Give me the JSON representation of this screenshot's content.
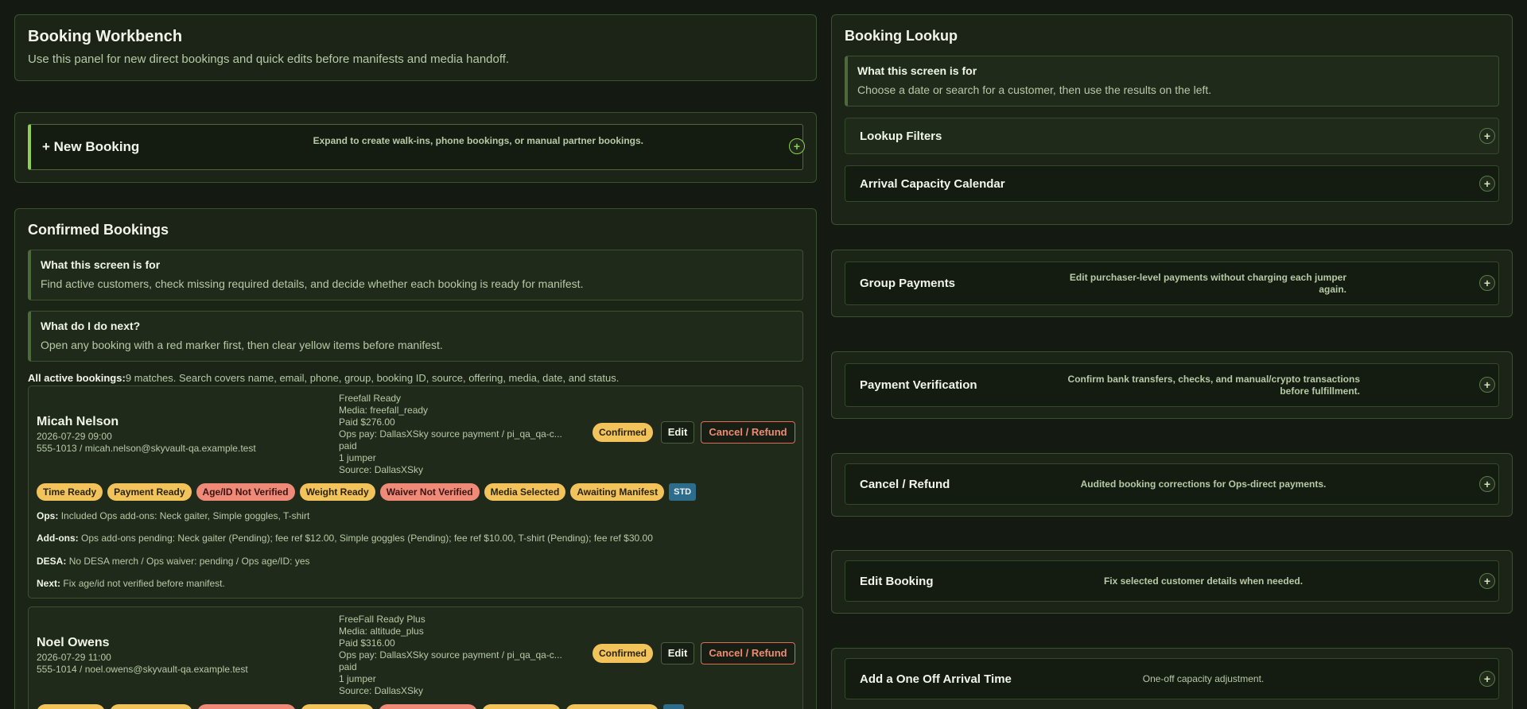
{
  "workbench": {
    "title": "Booking Workbench",
    "subtitle": "Use this panel for new direct bookings and quick edits before manifests and media handoff."
  },
  "new_booking": {
    "label": "+ New Booking",
    "description": "Expand to create walk-ins, phone bookings, or manual partner bookings.",
    "toggle": "+"
  },
  "confirmed": {
    "title": "Confirmed Bookings",
    "info1": {
      "title": "What this screen is for",
      "text": "Find active customers, check missing required details, and decide whether each booking is ready for manifest."
    },
    "info2": {
      "title": "What do I do next?",
      "text": "Open any booking with a red marker first, then clear yellow items before manifest."
    },
    "summary_label": "All active bookings:",
    "summary_text": "9 matches. Search covers name, email, phone, group, booking ID, source, offering, media, date, and status.",
    "bookings": [
      {
        "name": "Micah Nelson",
        "datetime": "2026-07-29 09:00",
        "contact": "555-1013 / micah.nelson@skyvault-qa.example.test",
        "offering": "Freefall Ready",
        "media": "Media: freefall_ready",
        "paid": "Paid $276.00",
        "ops_pay": "Ops pay: DallasXSky source payment / pi_qa_qa-c...",
        "pay_status": "paid",
        "jumpers": "1 jumper",
        "source": "Source: DallasXSky",
        "status": "Confirmed",
        "edit": "Edit",
        "cancel": "Cancel / Refund",
        "chips": [
          {
            "text": "Time Ready",
            "tone": "y"
          },
          {
            "text": "Payment Ready",
            "tone": "y"
          },
          {
            "text": "Age/ID Not Verified",
            "tone": "r"
          },
          {
            "text": "Weight Ready",
            "tone": "y"
          },
          {
            "text": "Waiver Not Verified",
            "tone": "r"
          },
          {
            "text": "Media Selected",
            "tone": "y"
          },
          {
            "text": "Awaiting Manifest",
            "tone": "y"
          },
          {
            "text": "STD",
            "tone": "std"
          }
        ],
        "ops_label": "Ops:",
        "ops_text": "Included Ops add-ons: Neck gaiter, Simple goggles, T-shirt",
        "addons_label": "Add-ons:",
        "addons_text": "Ops add-ons pending: Neck gaiter (Pending); fee ref $12.00, Simple goggles (Pending); fee ref $10.00, T-shirt (Pending); fee ref $30.00",
        "desa_label": "DESA:",
        "desa_text": "No DESA merch / Ops waiver: pending / Ops age/ID: yes",
        "next_label": "Next:",
        "next_text": "Fix age/id not verified before manifest."
      },
      {
        "name": "Noel Owens",
        "datetime": "2026-07-29 11:00",
        "contact": "555-1014 / noel.owens@skyvault-qa.example.test",
        "offering": "FreeFall Ready Plus",
        "media": "Media: altitude_plus",
        "paid": "Paid $316.00",
        "ops_pay": "Ops pay: DallasXSky source payment / pi_qa_qa-c...",
        "pay_status": "paid",
        "jumpers": "1 jumper",
        "source": "Source: DallasXSky",
        "status": "Confirmed",
        "edit": "Edit",
        "cancel": "Cancel / Refund"
      }
    ]
  },
  "lookup": {
    "title": "Booking Lookup",
    "info": {
      "title": "What this screen is for",
      "text": "Choose a date or search for a customer, then use the results on the left."
    },
    "filters": "Lookup Filters",
    "calendar": "Arrival Capacity Calendar"
  },
  "side_panels": [
    {
      "label": "Group Payments",
      "desc": "Edit purchaser-level payments without charging each jumper again."
    },
    {
      "label": "Payment Verification",
      "desc": "Confirm bank transfers, checks, and manual/crypto transactions before fulfillment."
    },
    {
      "label": "Cancel / Refund",
      "desc": "Audited booking corrections for Ops-direct payments."
    },
    {
      "label": "Edit Booking",
      "desc": "Fix selected customer details when needed."
    },
    {
      "label": "Add a One Off Arrival Time",
      "desc": "One-off capacity adjustment."
    }
  ],
  "colors": {
    "background": "#141a12",
    "panel": "#1b2417",
    "accent": "#8fd14f",
    "chip_yellow": "#f2c35a",
    "chip_red": "#f08a78"
  }
}
